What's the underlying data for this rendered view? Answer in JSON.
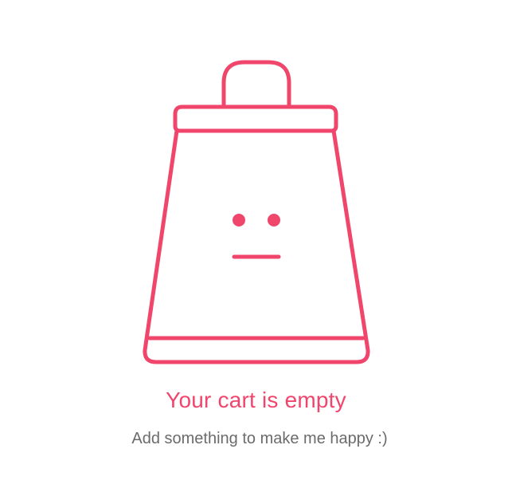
{
  "theme": {
    "accent": "#f0466c",
    "subtitle_color": "#6b6b6b",
    "background": "#ffffff"
  },
  "empty_state": {
    "icon": "shopping-bag-neutral-face-icon",
    "title": "Your cart is empty",
    "subtitle": "Add something to make me happy :)"
  }
}
